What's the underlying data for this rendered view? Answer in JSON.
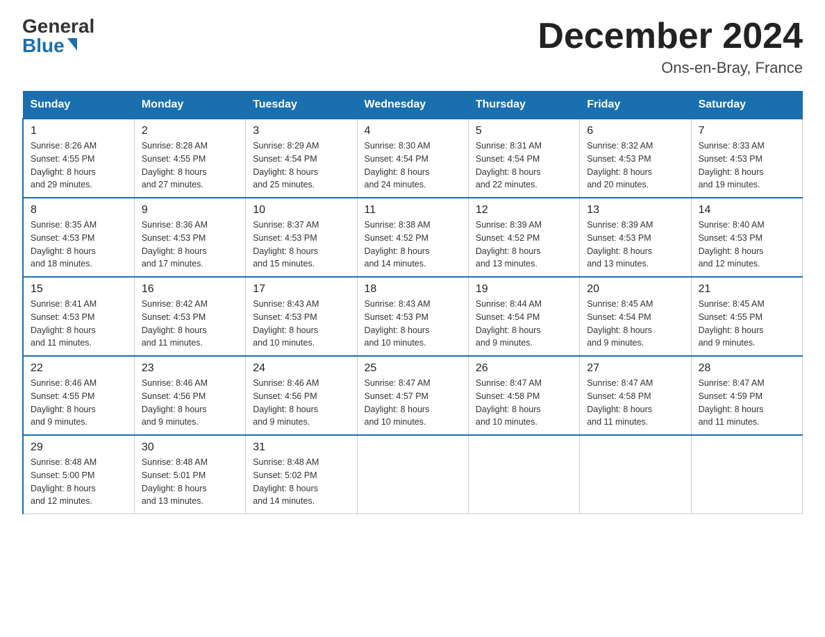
{
  "header": {
    "logo_general": "General",
    "logo_blue": "Blue",
    "month_title": "December 2024",
    "location": "Ons-en-Bray, France"
  },
  "weekdays": [
    "Sunday",
    "Monday",
    "Tuesday",
    "Wednesday",
    "Thursday",
    "Friday",
    "Saturday"
  ],
  "weeks": [
    [
      {
        "day": "1",
        "sunrise": "8:26 AM",
        "sunset": "4:55 PM",
        "daylight": "8 hours and 29 minutes."
      },
      {
        "day": "2",
        "sunrise": "8:28 AM",
        "sunset": "4:55 PM",
        "daylight": "8 hours and 27 minutes."
      },
      {
        "day": "3",
        "sunrise": "8:29 AM",
        "sunset": "4:54 PM",
        "daylight": "8 hours and 25 minutes."
      },
      {
        "day": "4",
        "sunrise": "8:30 AM",
        "sunset": "4:54 PM",
        "daylight": "8 hours and 24 minutes."
      },
      {
        "day": "5",
        "sunrise": "8:31 AM",
        "sunset": "4:54 PM",
        "daylight": "8 hours and 22 minutes."
      },
      {
        "day": "6",
        "sunrise": "8:32 AM",
        "sunset": "4:53 PM",
        "daylight": "8 hours and 20 minutes."
      },
      {
        "day": "7",
        "sunrise": "8:33 AM",
        "sunset": "4:53 PM",
        "daylight": "8 hours and 19 minutes."
      }
    ],
    [
      {
        "day": "8",
        "sunrise": "8:35 AM",
        "sunset": "4:53 PM",
        "daylight": "8 hours and 18 minutes."
      },
      {
        "day": "9",
        "sunrise": "8:36 AM",
        "sunset": "4:53 PM",
        "daylight": "8 hours and 17 minutes."
      },
      {
        "day": "10",
        "sunrise": "8:37 AM",
        "sunset": "4:53 PM",
        "daylight": "8 hours and 15 minutes."
      },
      {
        "day": "11",
        "sunrise": "8:38 AM",
        "sunset": "4:52 PM",
        "daylight": "8 hours and 14 minutes."
      },
      {
        "day": "12",
        "sunrise": "8:39 AM",
        "sunset": "4:52 PM",
        "daylight": "8 hours and 13 minutes."
      },
      {
        "day": "13",
        "sunrise": "8:39 AM",
        "sunset": "4:53 PM",
        "daylight": "8 hours and 13 minutes."
      },
      {
        "day": "14",
        "sunrise": "8:40 AM",
        "sunset": "4:53 PM",
        "daylight": "8 hours and 12 minutes."
      }
    ],
    [
      {
        "day": "15",
        "sunrise": "8:41 AM",
        "sunset": "4:53 PM",
        "daylight": "8 hours and 11 minutes."
      },
      {
        "day": "16",
        "sunrise": "8:42 AM",
        "sunset": "4:53 PM",
        "daylight": "8 hours and 11 minutes."
      },
      {
        "day": "17",
        "sunrise": "8:43 AM",
        "sunset": "4:53 PM",
        "daylight": "8 hours and 10 minutes."
      },
      {
        "day": "18",
        "sunrise": "8:43 AM",
        "sunset": "4:53 PM",
        "daylight": "8 hours and 10 minutes."
      },
      {
        "day": "19",
        "sunrise": "8:44 AM",
        "sunset": "4:54 PM",
        "daylight": "8 hours and 9 minutes."
      },
      {
        "day": "20",
        "sunrise": "8:45 AM",
        "sunset": "4:54 PM",
        "daylight": "8 hours and 9 minutes."
      },
      {
        "day": "21",
        "sunrise": "8:45 AM",
        "sunset": "4:55 PM",
        "daylight": "8 hours and 9 minutes."
      }
    ],
    [
      {
        "day": "22",
        "sunrise": "8:46 AM",
        "sunset": "4:55 PM",
        "daylight": "8 hours and 9 minutes."
      },
      {
        "day": "23",
        "sunrise": "8:46 AM",
        "sunset": "4:56 PM",
        "daylight": "8 hours and 9 minutes."
      },
      {
        "day": "24",
        "sunrise": "8:46 AM",
        "sunset": "4:56 PM",
        "daylight": "8 hours and 9 minutes."
      },
      {
        "day": "25",
        "sunrise": "8:47 AM",
        "sunset": "4:57 PM",
        "daylight": "8 hours and 10 minutes."
      },
      {
        "day": "26",
        "sunrise": "8:47 AM",
        "sunset": "4:58 PM",
        "daylight": "8 hours and 10 minutes."
      },
      {
        "day": "27",
        "sunrise": "8:47 AM",
        "sunset": "4:58 PM",
        "daylight": "8 hours and 11 minutes."
      },
      {
        "day": "28",
        "sunrise": "8:47 AM",
        "sunset": "4:59 PM",
        "daylight": "8 hours and 11 minutes."
      }
    ],
    [
      {
        "day": "29",
        "sunrise": "8:48 AM",
        "sunset": "5:00 PM",
        "daylight": "8 hours and 12 minutes."
      },
      {
        "day": "30",
        "sunrise": "8:48 AM",
        "sunset": "5:01 PM",
        "daylight": "8 hours and 13 minutes."
      },
      {
        "day": "31",
        "sunrise": "8:48 AM",
        "sunset": "5:02 PM",
        "daylight": "8 hours and 14 minutes."
      },
      null,
      null,
      null,
      null
    ]
  ],
  "labels": {
    "sunrise": "Sunrise:",
    "sunset": "Sunset:",
    "daylight": "Daylight:"
  }
}
